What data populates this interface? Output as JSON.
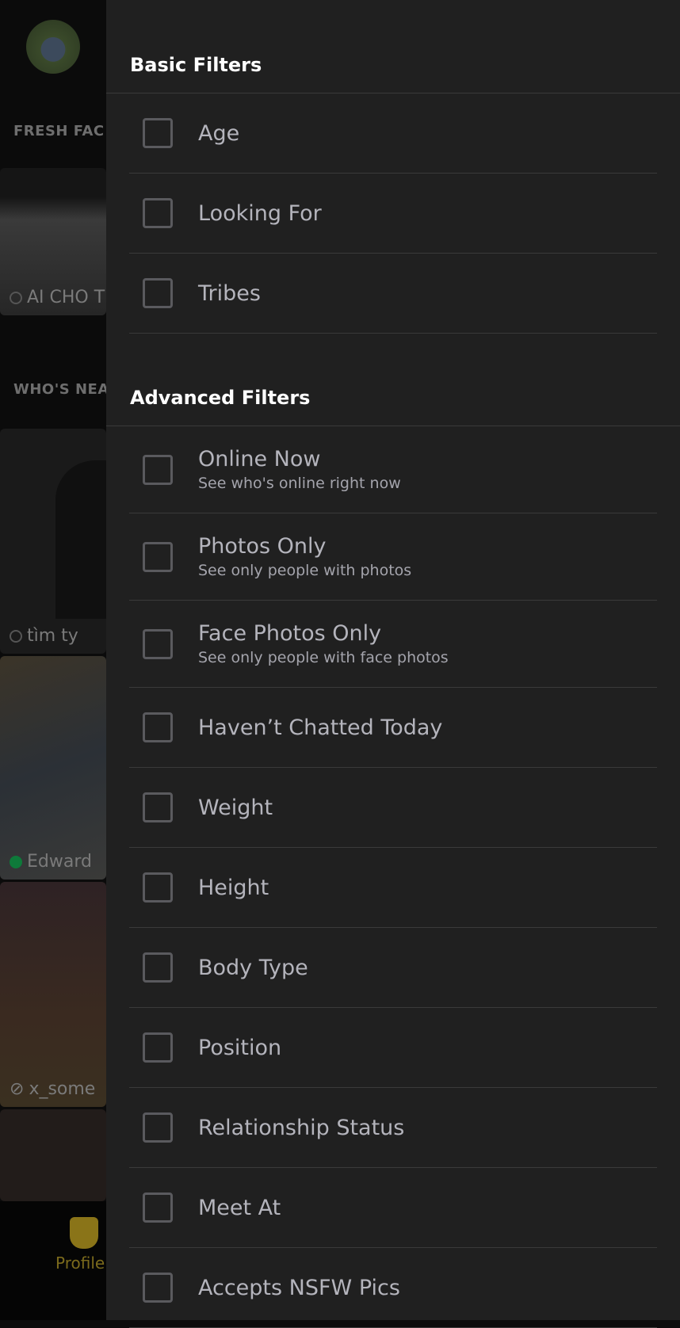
{
  "background": {
    "sections": [
      "FRESH FAC",
      "WHO'S NEA"
    ],
    "cards": [
      {
        "name": "AI CHO T",
        "status": "offline"
      },
      {
        "name": "tìm ty",
        "status": "offline"
      },
      {
        "name": "Edward",
        "status": "online"
      },
      {
        "name": "x_some",
        "status": "away"
      }
    ],
    "nav": {
      "profile_label": "Profile",
      "accent": "#8a7418"
    }
  },
  "filters": {
    "basic_title": "Basic Filters",
    "basic": [
      {
        "label": "Age",
        "checked": false
      },
      {
        "label": "Looking For",
        "checked": false
      },
      {
        "label": "Tribes",
        "checked": false
      }
    ],
    "advanced_title": "Advanced Filters",
    "advanced": [
      {
        "label": "Online Now",
        "sub": "See who's online right now",
        "checked": false
      },
      {
        "label": "Photos Only",
        "sub": "See only people with photos",
        "checked": false
      },
      {
        "label": "Face Photos Only",
        "sub": "See only people with face photos",
        "checked": false
      },
      {
        "label": "Haven’t Chatted Today",
        "checked": false
      },
      {
        "label": "Weight",
        "checked": false
      },
      {
        "label": "Height",
        "checked": false
      },
      {
        "label": "Body Type",
        "checked": false
      },
      {
        "label": "Position",
        "checked": false
      },
      {
        "label": "Relationship Status",
        "checked": false
      },
      {
        "label": "Meet At",
        "checked": false
      },
      {
        "label": "Accepts NSFW Pics",
        "checked": false
      }
    ]
  }
}
